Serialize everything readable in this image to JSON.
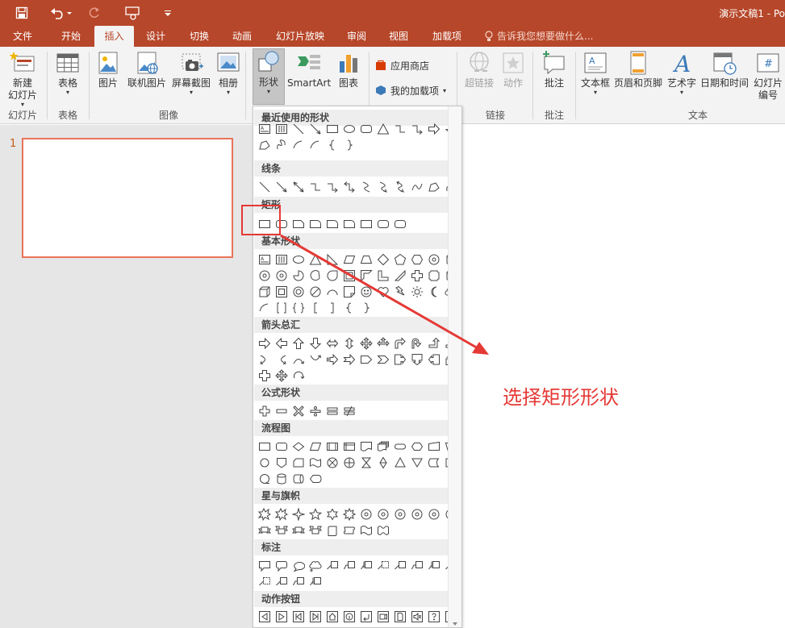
{
  "titlebar": {
    "doc_title": "演示文稿1 - Po",
    "quick_access": [
      "save-icon",
      "undo-icon",
      "redo-icon",
      "touch-mode-icon",
      "customize-icon"
    ]
  },
  "tabs": [
    "文件",
    "开始",
    "插入",
    "设计",
    "切换",
    "动画",
    "幻灯片放映",
    "审阅",
    "视图",
    "加载项"
  ],
  "active_tab": "插入",
  "tell_me": "告诉我您想要做什么...",
  "ribbon": {
    "new_slide": [
      "新建",
      "幻灯片"
    ],
    "table": "表格",
    "picture": "图片",
    "online_picture": "联机图片",
    "screenshot": "屏幕截图",
    "album": "相册",
    "shapes": "形状",
    "smartart": "SmartArt",
    "chart": "图表",
    "app_store": "应用商店",
    "my_addins": "我的加载项",
    "hyperlink": "超链接",
    "action": "动作",
    "comment": "批注",
    "textbox": "文本框",
    "header_footer": "页眉和页脚",
    "wordart": "艺术字",
    "datetime": "日期和时间",
    "slide_number": [
      "幻灯片",
      "编号"
    ],
    "groups": {
      "slides": "幻灯片",
      "tables": "表格",
      "images": "图像",
      "links": "链接",
      "comments": "批注",
      "text": "文本"
    }
  },
  "slide_pane": {
    "slide_number": "1"
  },
  "gallery": {
    "sections": [
      "最近使用的形状",
      "线条",
      "矩形",
      "基本形状",
      "箭头总汇",
      "公式形状",
      "流程图",
      "星与旗帜",
      "标注",
      "动作按钮"
    ]
  },
  "annotation": "选择矩形形状",
  "colors": {
    "accent": "#b7472a",
    "annotation": "#e53935"
  }
}
